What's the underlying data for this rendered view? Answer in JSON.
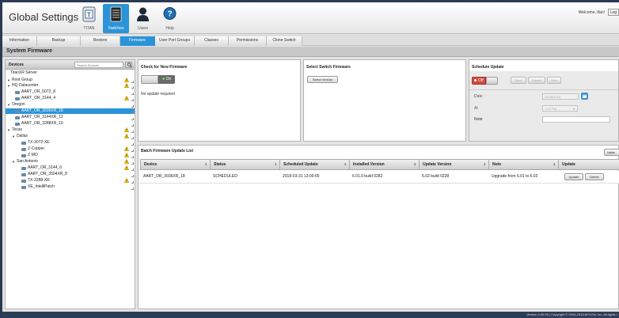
{
  "app_title": "Global Settings",
  "header_buttons": [
    {
      "label": "TITAN",
      "icon": "titan-icon"
    },
    {
      "label": "Switches",
      "icon": "switch-icon"
    },
    {
      "label": "Users",
      "icon": "user-icon"
    },
    {
      "label": "Help",
      "icon": "help-icon"
    }
  ],
  "welcome": "Welcome, tfan!",
  "logout_label": "Log",
  "tabs": [
    "Information",
    "Backup",
    "Restore",
    "Firmware",
    "User Port Groups",
    "Classes",
    "Permissions",
    "Clone Switch"
  ],
  "active_tab": "Firmware",
  "page_title": "System Firmware",
  "devices": {
    "title": "Devices",
    "search_placeholder": "Search Devices",
    "tree": [
      {
        "label": "TitanXR Server",
        "level": 0,
        "type": "text",
        "warn": false
      },
      {
        "label": "Root Group",
        "level": 0,
        "type": "group",
        "warn": true
      },
      {
        "label": "HQ Datacenter",
        "level": 1,
        "type": "group",
        "warn": true
      },
      {
        "label": "AART_OR_5072_8",
        "level": 2,
        "type": "device",
        "warn": false
      },
      {
        "label": "AART_OR_3144_4",
        "level": 2,
        "type": "device",
        "warn": true
      },
      {
        "label": "Oregon",
        "level": 1,
        "type": "group",
        "warn": false
      },
      {
        "label": "AART_OR_3036XR_18",
        "level": 2,
        "type": "device",
        "warn": false,
        "selected": true
      },
      {
        "label": "AART_OR_3144XR_12",
        "level": 2,
        "type": "device",
        "warn": false
      },
      {
        "label": "AART_OR_3288XR_10",
        "level": 2,
        "type": "device",
        "warn": false
      },
      {
        "label": "Texas",
        "level": 1,
        "type": "group",
        "warn": true
      },
      {
        "label": "Dallas",
        "level": 2,
        "type": "group",
        "warn": true
      },
      {
        "label": "TX-3072-XE",
        "level": 3,
        "type": "device",
        "warn": false
      },
      {
        "label": "Z-Copper",
        "level": 3,
        "type": "device",
        "warn": true
      },
      {
        "label": "Z-MO",
        "level": 3,
        "type": "device",
        "warn": true
      },
      {
        "label": "San Antonio",
        "level": 2,
        "type": "group",
        "warn": true
      },
      {
        "label": "AART_OR_3144_6",
        "level": 3,
        "type": "device",
        "warn": true
      },
      {
        "label": "AART_OR_3504XR_8",
        "level": 3,
        "type": "device",
        "warn": false
      },
      {
        "label": "TX-3288-XR",
        "level": 3,
        "type": "device",
        "warn": true
      },
      {
        "label": "XE_IntelliPatch",
        "level": 3,
        "type": "device",
        "warn": false
      }
    ]
  },
  "check_firmware": {
    "title": "Check for New Firmware",
    "toggle_on_label": "On",
    "status": "No update required"
  },
  "select_firmware": {
    "title": "Select Switch Firmware",
    "button": "Select Version"
  },
  "schedule": {
    "title": "Schedule Update",
    "toggle_off_label": "Off",
    "buttons": [
      "Save",
      "Cancel",
      "Now"
    ],
    "date_label": "Date",
    "date_value": "03/28/2018",
    "at_label": "At",
    "at_value": "1:00 PM",
    "note_label": "Note",
    "note_value": ""
  },
  "batch": {
    "title": "Batch Firmware Update List",
    "top_button": "Upda",
    "columns": [
      "Device",
      "Status",
      "Scheduled Update",
      "Installed Version",
      "Update Version",
      "Note",
      "Update"
    ],
    "rows": [
      {
        "device": "AART_OR_3036XR_18",
        "status": "SCHEDULED",
        "scheduled": "2018-03-31 13:00:00",
        "installed": "6.01.0 build 0282",
        "update": "6.02 build 0228",
        "note": "Upgrade from 6.01 to 6.02",
        "btn_update": "Update",
        "btn_delete": "Delete"
      }
    ]
  },
  "footer": "Version 4.00.93 | Copyright © 2004-2018 APCON, Inc. All rights r",
  "colors": {
    "accent": "#2b93d8",
    "page_bg": "#2a3a56",
    "warn": "#f0c000",
    "off": "#d14a3a"
  }
}
